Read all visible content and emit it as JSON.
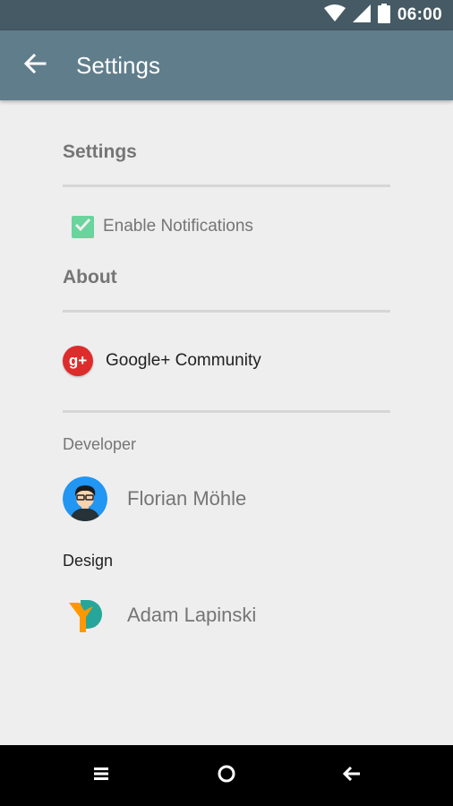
{
  "status_bar": {
    "time": "06:00"
  },
  "app_bar": {
    "title": "Settings"
  },
  "settings_section": {
    "title": "Settings",
    "notifications": {
      "label": "Enable Notifications",
      "checked": true
    }
  },
  "about_section": {
    "title": "About",
    "community_link": {
      "label": "Google+ Community",
      "icon_text": "g+"
    }
  },
  "credits": {
    "developer_label": "Developer",
    "developer_name": "Florian Möhle",
    "design_label": "Design",
    "designer_name": "Adam Lapinski"
  },
  "colors": {
    "status_bar": "#455a64",
    "app_bar": "#607d8b",
    "checkbox": "#69d49c",
    "gplus": "#dd2c2c",
    "background": "#eeeeee"
  },
  "icons": [
    "wifi-icon",
    "signal-icon",
    "battery-icon",
    "back-arrow-icon",
    "checkmark-icon",
    "google-plus-icon",
    "developer-avatar",
    "designer-logo",
    "recents-icon",
    "home-icon",
    "nav-back-icon"
  ]
}
